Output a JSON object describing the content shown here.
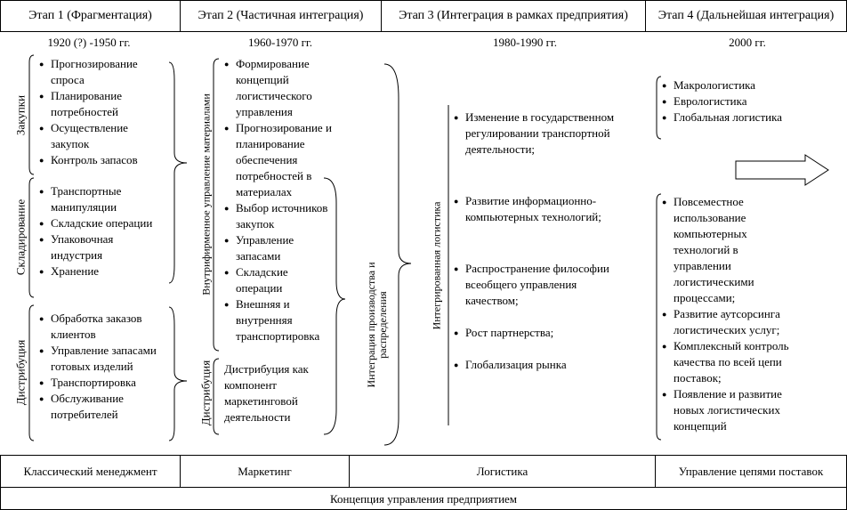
{
  "stages": [
    {
      "title": "Этап 1 (Фрагментация)",
      "period": "1920 (?) -1950 гг."
    },
    {
      "title": "Этап 2 (Частичная интеграция)",
      "period": "1960-1970  гг."
    },
    {
      "title": "Этап 3 (Интеграция в рамках предприятия)",
      "period": "1980-1990 гг."
    },
    {
      "title": "Этап 4 (Дальнейшая интеграция)",
      "period": "2000 гг."
    }
  ],
  "stage1": {
    "groups": [
      {
        "label": "Закупки",
        "items": [
          "Прогнозирование спроса",
          "Планирование потребностей",
          "Осуществление закупок",
          "Контроль запасов"
        ]
      },
      {
        "label": "Складирование",
        "items": [
          "Транспортные манипуляции",
          "Складские операции",
          "Упаковочная индустрия",
          "Хранение"
        ]
      },
      {
        "label": "Дистрибуция",
        "items": [
          "Обработка заказов клиентов",
          "Управление запасами готовых изделий",
          "Транспортировка",
          "Обслуживание потребителей"
        ]
      }
    ]
  },
  "stage2": {
    "group1_label": "Внутрифирменное управление материалами",
    "group2_label": "Дистрибуция",
    "items": [
      "Формирование концепций логистического управления",
      "Прогнозирование и планирование обеспечения потребностей в материалах",
      "Выбор источников закупок",
      "Управление запасами",
      "Складские операции",
      "Внешняя и внутренняя транспортировка"
    ],
    "distribution_text": "Дистрибуция как компонент маркетинговой деятельности",
    "integration_label": "Интеграция производства и распределения"
  },
  "stage3": {
    "label": "Интегрированная логистика",
    "items": [
      "Изменение в государственном регулировании транспортной деятельности;",
      "Развитие информационно-компьютерных технологий;",
      "Распространение философии всеобщего управления качеством;",
      "Рост партнерства;",
      "Глобализация рынка"
    ]
  },
  "stage4": {
    "items_top": [
      "Макрологистика",
      "Еврологистика",
      "Глобальная логистика"
    ],
    "items_bottom": [
      "Повсеместное использование компьютерных технологий в управлении логистическими процессами;",
      "Развитие аутсорсинга логистических услуг;",
      "Комплексный контроль качества по всей цепи поставок;",
      "Появление и развитие новых логистических концепций"
    ]
  },
  "footer": {
    "row1": [
      "Классический менеджмент",
      "Маркетинг",
      "Логистика",
      "Управление цепями поставок"
    ],
    "row2": "Концепция управления предприятием"
  }
}
